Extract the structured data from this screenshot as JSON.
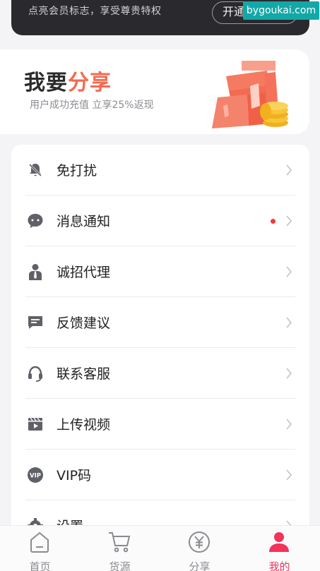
{
  "vip_banner": {
    "text": "点亮会员标志，享受尊贵特权",
    "button_label": "开通"
  },
  "watermark": "bygoukai.com",
  "share": {
    "title_part1": "我要",
    "title_part2": "分享",
    "subtitle": "用户成功充值 立享25%返现"
  },
  "menu": {
    "items": [
      {
        "label": "免打扰",
        "icon": "bell-off-icon"
      },
      {
        "label": "消息通知",
        "icon": "chat-bubble-icon",
        "has_dot": true
      },
      {
        "label": "诚招代理",
        "icon": "person-tie-icon"
      },
      {
        "label": "反馈建议",
        "icon": "feedback-icon"
      },
      {
        "label": "联系客服",
        "icon": "headset-icon"
      },
      {
        "label": "上传视频",
        "icon": "video-icon"
      },
      {
        "label": "VIP码",
        "icon": "vip-badge-icon",
        "icon_text": "VIP"
      },
      {
        "label": "设置",
        "icon": "gear-icon"
      }
    ]
  },
  "tabbar": {
    "tabs": [
      {
        "label": "首页",
        "icon": "home-icon",
        "active": false
      },
      {
        "label": "货源",
        "icon": "cart-icon",
        "active": false
      },
      {
        "label": "分享",
        "icon": "yen-circle-icon",
        "active": false
      },
      {
        "label": "我的",
        "icon": "user-icon",
        "active": true
      }
    ]
  },
  "colors": {
    "accent": "#f26b4f",
    "active_tab": "#f2335a",
    "badge_dot": "#f23b3b",
    "icon_gray": "#5f6068"
  }
}
